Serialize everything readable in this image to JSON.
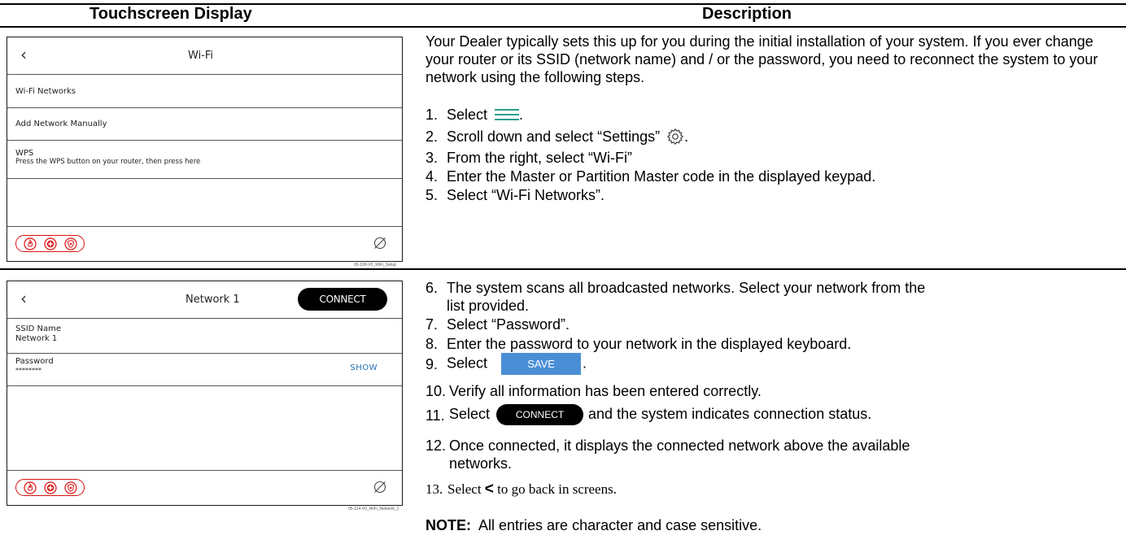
{
  "table": {
    "col1_header": "Touchscreen Display",
    "col2_header": "Description"
  },
  "screen1": {
    "title": "Wi-Fi",
    "back_icon": "chevron-left-icon",
    "rows": [
      "Wi-Fi Networks",
      "Add Network Manually"
    ],
    "wps_title": "WPS",
    "wps_sub": "Press the WPS button on your router, then press here",
    "footer_icons": [
      "fire-icon",
      "medical-icon",
      "police-icon"
    ],
    "code": "05-109-V0_WiFi_Setup"
  },
  "screen2": {
    "title": "Network 1",
    "connect_label": "CONNECT",
    "ssid_label": "SSID Name",
    "ssid_value": "Network 1",
    "password_label": "Password",
    "password_value": "********",
    "show_label": "SHOW",
    "code": "05-114-V0_WiFi_Network_1"
  },
  "section1": {
    "intro": "Your Dealer typically sets this up for you during the initial installation of your system.  If you ever change your router or its SSID (network name) and / or the password, you need to reconnect the system to your network using the following steps.",
    "steps": [
      {
        "num": "1.",
        "text": "Select",
        "after": "."
      },
      {
        "num": "2.",
        "text": "Scroll down and select “Settings”",
        "after": "."
      },
      {
        "num": "3.",
        "text": "From the right, select “Wi-Fi”"
      },
      {
        "num": "4.",
        "text": "Enter the Master or Partition Master code in the displayed keypad."
      },
      {
        "num": "5.",
        "text": "Select “Wi-Fi Networks”."
      }
    ]
  },
  "section2": {
    "step6_num": "6.",
    "step6_a": "The system scans all broadcasted networks.  Select your network from the",
    "step6_b": "list provided.",
    "step7_num": "7.",
    "step7": "Select “Password”.",
    "step8_num": "8.",
    "step8": "Enter the password to your network in the displayed keyboard.",
    "step9_num": "9.",
    "step9": "Select",
    "save_label": "SAVE",
    "step10_num": "10.",
    "step10": "Verify all information has been entered correctly.",
    "step11_num": "11.",
    "step11_a": "Select",
    "connect_label": "CONNECT",
    "step11_b": "and the system indicates connection status.",
    "step12_num": "12.",
    "step12_a": "Once connected, it displays the connected network above the available",
    "step12_b": "networks.",
    "step13_num": "13.",
    "step13_a": "Select",
    "step13_b": "to go back in screens.",
    "note_label": "NOTE:",
    "note_text": "All entries are character and case sensitive."
  }
}
